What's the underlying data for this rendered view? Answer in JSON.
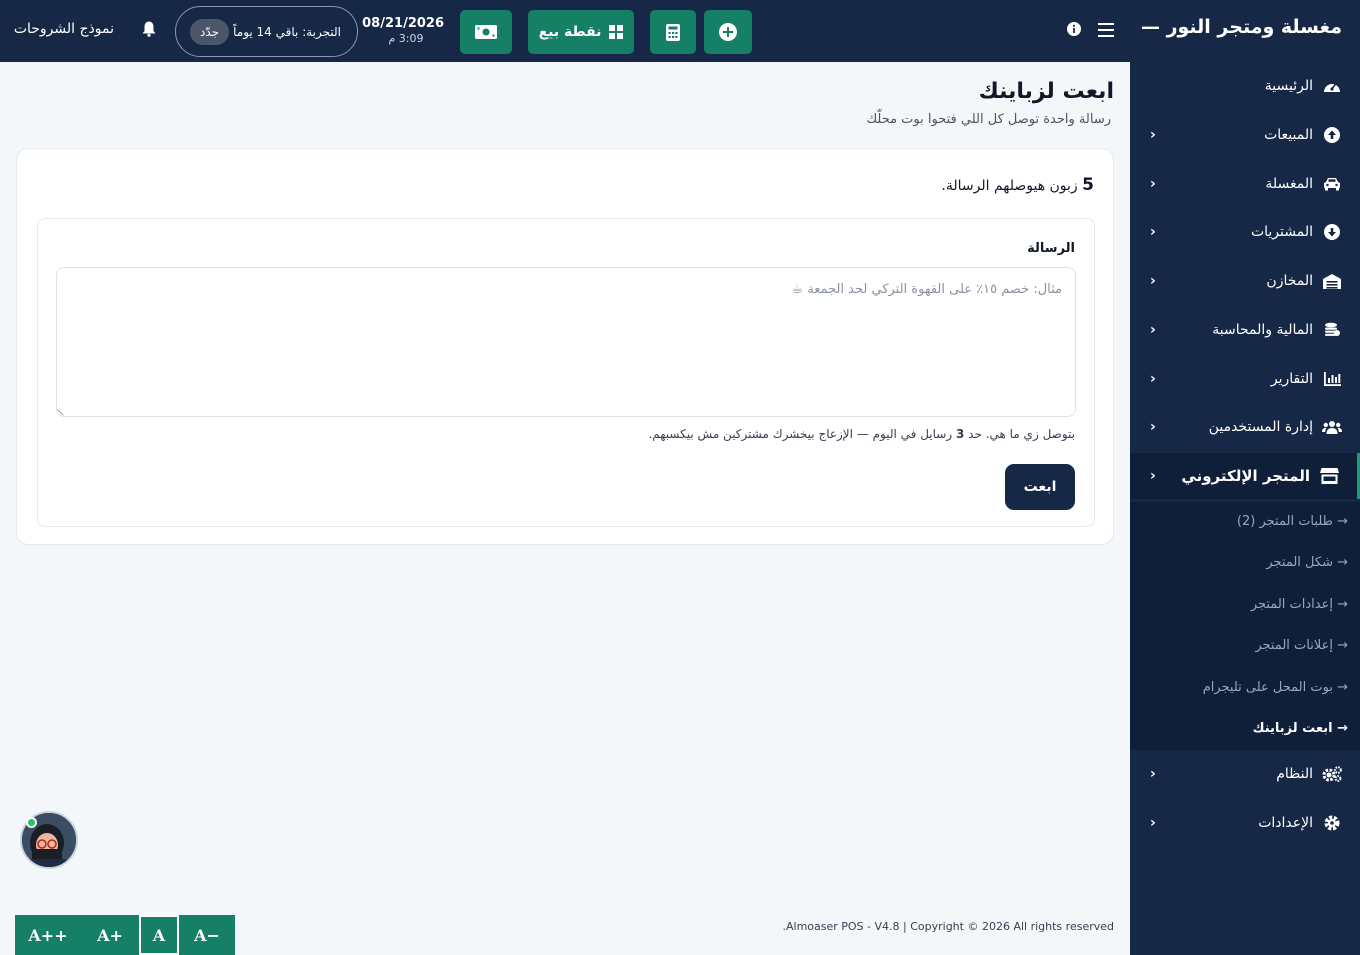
{
  "header": {
    "brand": "مغسلة ومتجر النور —",
    "pos_label": "نقطة بيع",
    "date": "08/21/2026",
    "time": "3:09 م",
    "trial_text": "التجربة: باقي 14 يوماً",
    "renew_label": "جدّد",
    "shortcuts_label": "نموذج الشروحات"
  },
  "sidebar": {
    "items": [
      {
        "label": "الرئيسية",
        "icon": "dashboard-icon"
      },
      {
        "label": "المبيعات",
        "icon": "arrow-up-circle-icon"
      },
      {
        "label": "المغسلة",
        "icon": "car-icon"
      },
      {
        "label": "المشتريات",
        "icon": "arrow-down-circle-icon"
      },
      {
        "label": "المخازن",
        "icon": "warehouse-icon"
      },
      {
        "label": "المالية والمحاسبة",
        "icon": "coins-icon"
      },
      {
        "label": "التقارير",
        "icon": "chart-icon"
      },
      {
        "label": "إدارة المستخدمين",
        "icon": "users-icon"
      },
      {
        "label": "المتجر الإلكتروني",
        "icon": "store-icon"
      },
      {
        "label": "النظام",
        "icon": "cogs-icon"
      },
      {
        "label": "الإعدادات",
        "icon": "gear-icon"
      }
    ],
    "submenu": [
      "→ طلبات المتجر (2)",
      "→ شكل المتجر",
      "→ إعدادات المتجر",
      "→ إعلانات المتجر",
      "→ بوت المحل على تليجرام",
      "→ ابعت لزباينك"
    ]
  },
  "main": {
    "title": "ابعت لزباينك",
    "subtitle": "رسالة واحدة توصل كل اللي فتحوا بوت محلّك",
    "recipients_count": "5",
    "recipients_text": "زبون هيوصلهم الرسالة.",
    "message_label": "الرسالة",
    "message_placeholder": "مثال: خصم ١٥٪ على القهوة التركي لحد الجمعة ☕",
    "hint_before": "بتوصل زي ما هي. حد",
    "hint_limit": "3",
    "hint_after": "رسايل في اليوم — الإزعاج بيخشرك مشتركين مش بيكسبهم.",
    "send_label": "ابعت"
  },
  "footer": {
    "copyright": "Almoaser POS - V4.8 | Copyright © 2026 All rights reserved."
  },
  "font_controls": [
    "A++",
    "A+",
    "A",
    "A−"
  ],
  "colors": {
    "navy": "#162846",
    "navy_dark": "#0f1f3a",
    "green": "#158066",
    "accent": "#1a9a7b"
  }
}
